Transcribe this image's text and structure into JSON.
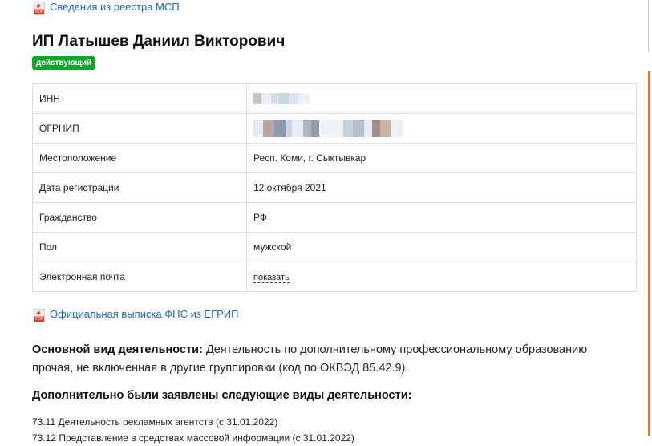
{
  "header": {
    "msp_link": "Сведения из реестра МСП",
    "pdf_icon_text": "PDF"
  },
  "entity": {
    "name": "ИП Латышев Даниил Викторович",
    "status": "действующий"
  },
  "info_rows": [
    {
      "label": "ИНН",
      "value": ""
    },
    {
      "label": "ОГРНИП",
      "value": ""
    },
    {
      "label": "Местоположение",
      "value": "Респ. Коми, г. Сыктывкар"
    },
    {
      "label": "Дата регистрации",
      "value": "12 октября 2021"
    },
    {
      "label": "Гражданство",
      "value": "РФ"
    },
    {
      "label": "Пол",
      "value": "мужской"
    },
    {
      "label": "Электронная почта",
      "value": "показать"
    }
  ],
  "egrip_link": "Официальная выписка ФНС из ЕГРИП",
  "main_activity": {
    "label": "Основной вид деятельности:",
    "text": " Деятельность по дополнительному профессиональному образованию прочая, не включенная в другие группировки (код по ОКВЭД 85.42.9)."
  },
  "additional": {
    "heading": "Дополнительно были заявлены следующие виды деятельности:",
    "items": [
      "73.11 Деятельность рекламных агентств (с 31.01.2022)",
      "73.12 Представление в средствах массовой информации (с 31.01.2022)"
    ]
  },
  "colors": {
    "link": "#1f66b8",
    "status_badge": "#14a32a",
    "scroll_accent": "#e8762c"
  }
}
